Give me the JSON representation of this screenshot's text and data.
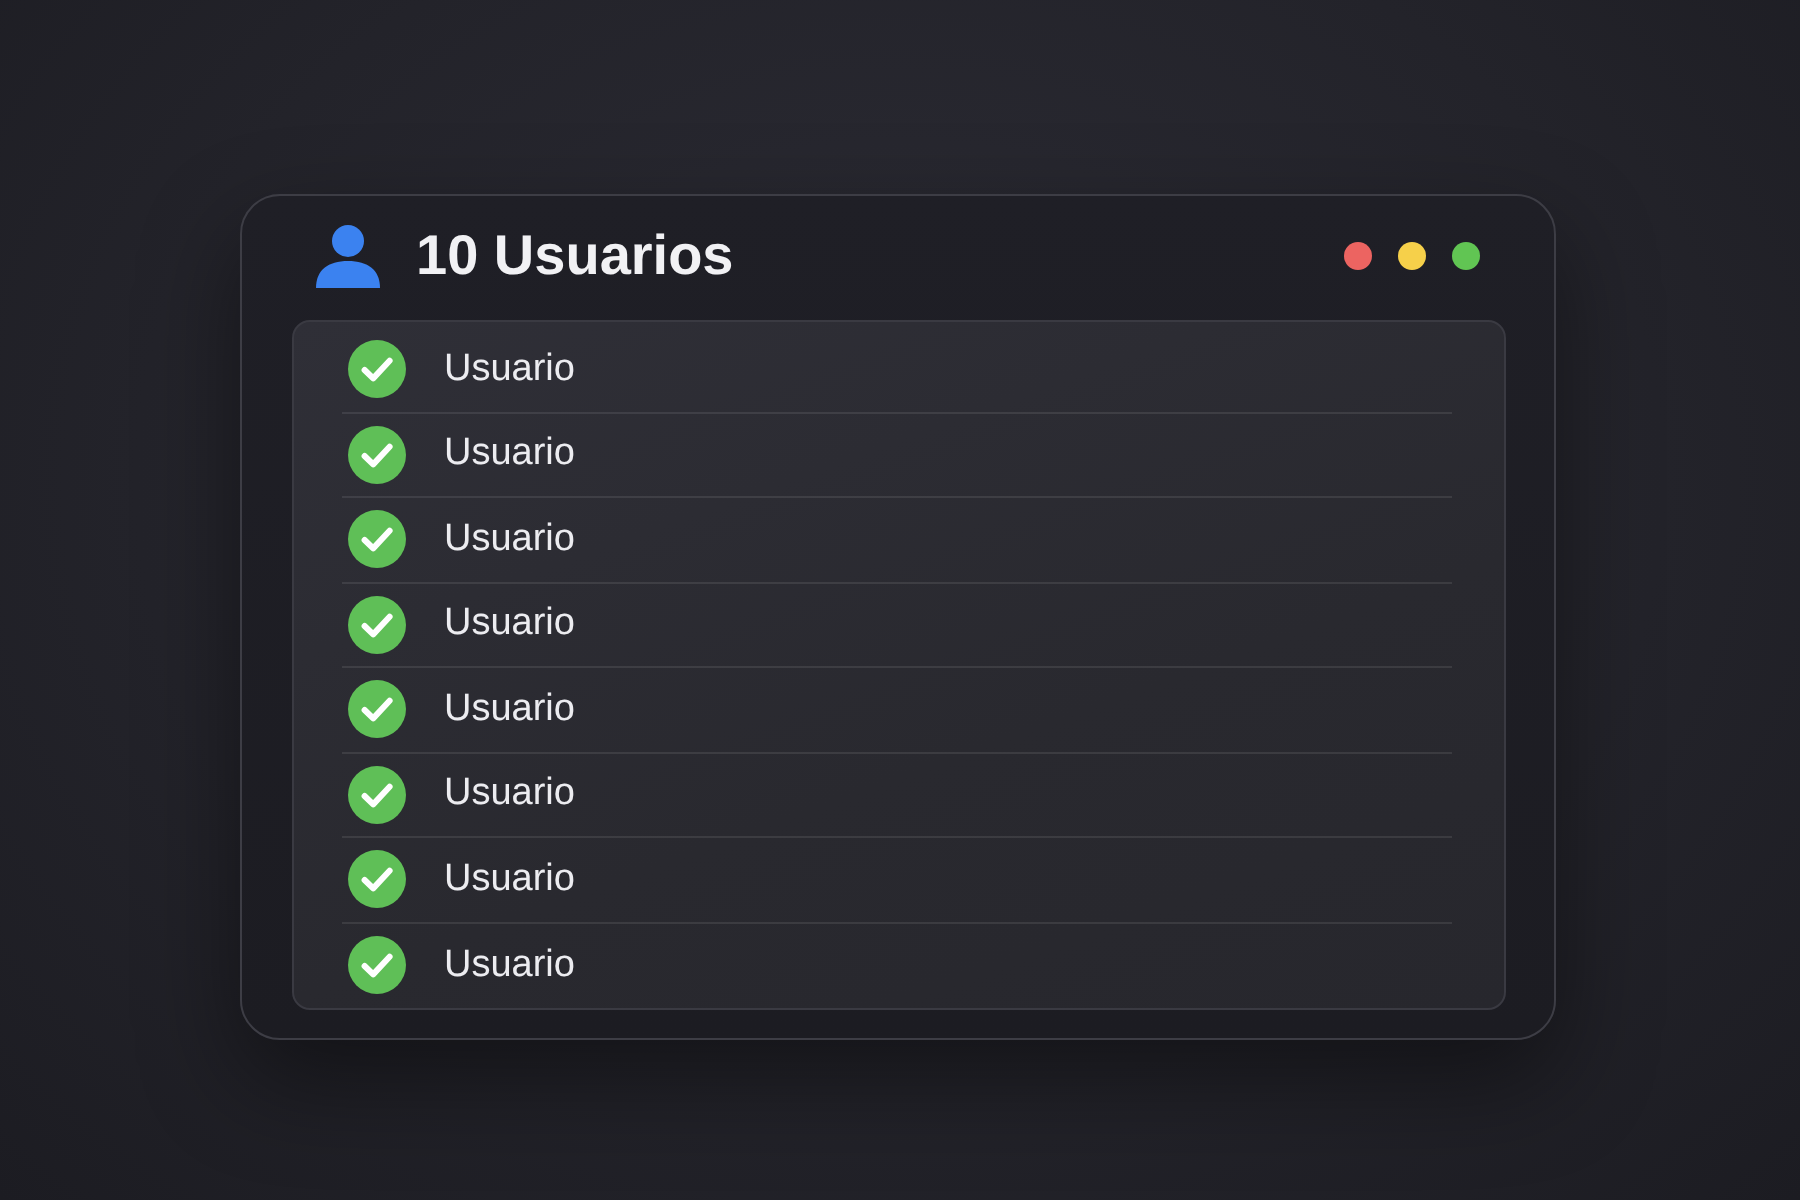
{
  "window": {
    "title": "10 Usuarios",
    "window_controls": [
      {
        "color": "#ec6461"
      },
      {
        "color": "#f6d04a"
      },
      {
        "color": "#61c553"
      }
    ]
  },
  "users": [
    {
      "label": "Usuario",
      "checked": true
    },
    {
      "label": "Usuario",
      "checked": true
    },
    {
      "label": "Usuario",
      "checked": true
    },
    {
      "label": "Usuario",
      "checked": true
    },
    {
      "label": "Usuario",
      "checked": true
    },
    {
      "label": "Usuario",
      "checked": true
    },
    {
      "label": "Usuario",
      "checked": true
    },
    {
      "label": "Usuario",
      "checked": true
    }
  ]
}
